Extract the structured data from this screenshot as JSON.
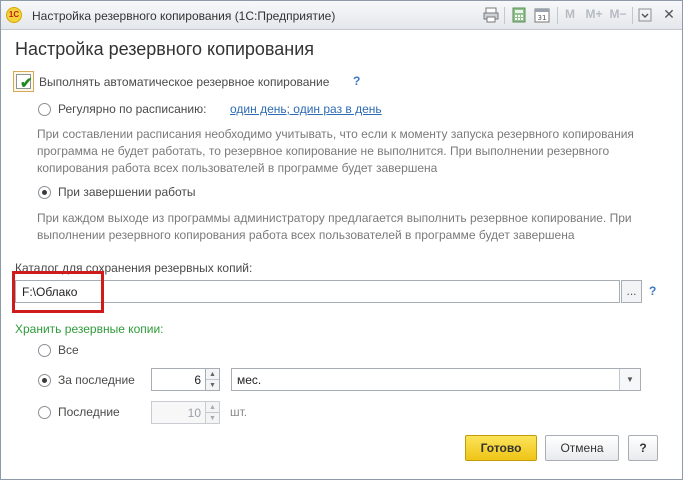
{
  "window": {
    "title": "Настройка резервного копирования (1С:Предприятие)",
    "logo_text": "1С",
    "toolbar": {
      "m": "M",
      "m_plus": "M+",
      "m_minus": "M−"
    },
    "colors": {
      "accent_button": "#f2c81b",
      "highlight_box": "#d01b1b",
      "link": "#2e6bb5",
      "green_label": "#2f9b3a"
    }
  },
  "form": {
    "heading": "Настройка резервного копирования",
    "auto_backup": {
      "label": "Выполнять автоматическое резервное копирование",
      "checked": true,
      "help": "?"
    },
    "schedule": {
      "label": "Регулярно по расписанию:",
      "link": "один день; один раз в день",
      "note": "При составлении расписания необходимо учитывать, что если к моменту запуска резервного копирования программа не будет работать, то резервное копирование не выполнится. При выполнении резервного копирования работа всех пользователей в программе будет завершена"
    },
    "on_exit": {
      "label": "При завершении работы",
      "note": "При каждом выходе из программы администратору предлагается выполнить резервное копирование. При выполнении резервного копирования работа всех пользователей в программе будет завершена"
    },
    "catalog": {
      "label": "Каталог для сохранения резервных копий:",
      "value": "F:\\Облако",
      "browse": "...",
      "help": "?"
    },
    "keep": {
      "label": "Хранить резервные копии:",
      "all_label": "Все",
      "last_period_label": "За последние",
      "last_period_value": "6",
      "period_unit": "мес.",
      "last_count_label": "Последние",
      "last_count_value": "10",
      "count_unit": "шт."
    },
    "buttons": {
      "done": "Готово",
      "cancel": "Отмена",
      "help": "?"
    }
  }
}
